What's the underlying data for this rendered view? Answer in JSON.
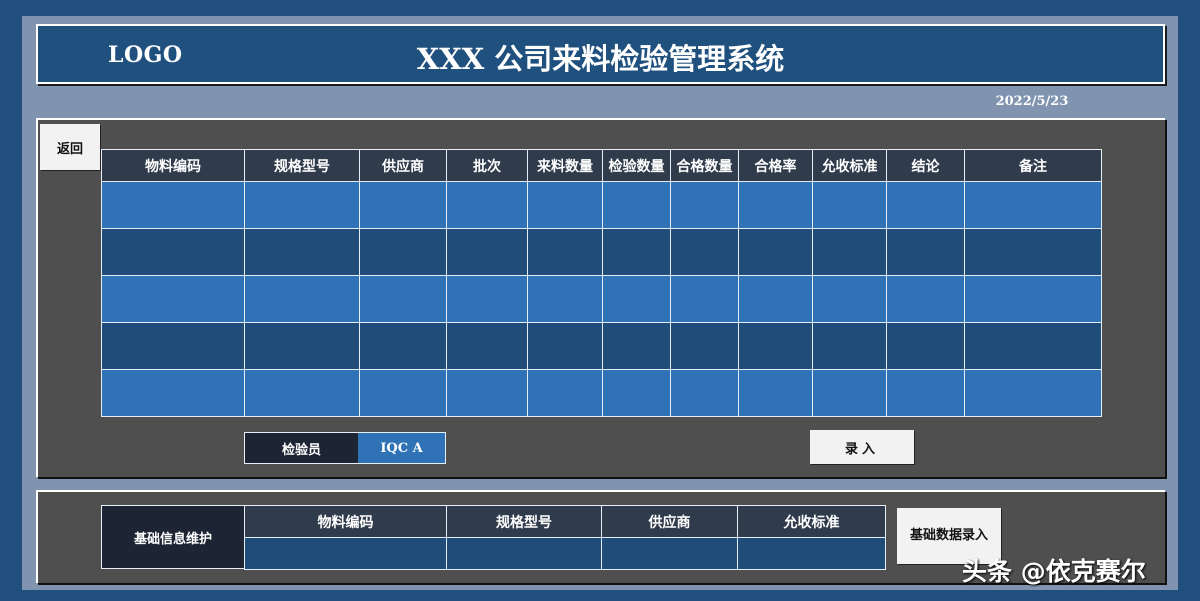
{
  "header": {
    "logo": "LOGO",
    "title": "XXX 公司来料检验管理系统",
    "date": "2022/5/23"
  },
  "buttons": {
    "back": "返回",
    "enter": "录入",
    "basic_entry": "基础数据录入"
  },
  "main_table": {
    "columns": [
      "物料编码",
      "规格型号",
      "供应商",
      "批次",
      "来料数量",
      "检验数量",
      "合格数量",
      "合格率",
      "允收标准",
      "结论",
      "备注"
    ],
    "rows": [
      [
        "",
        "",
        "",
        "",
        "",
        "",
        "",
        "",
        "",
        "",
        ""
      ],
      [
        "",
        "",
        "",
        "",
        "",
        "",
        "",
        "",
        "",
        "",
        ""
      ],
      [
        "",
        "",
        "",
        "",
        "",
        "",
        "",
        "",
        "",
        "",
        ""
      ],
      [
        "",
        "",
        "",
        "",
        "",
        "",
        "",
        "",
        "",
        "",
        ""
      ],
      [
        "",
        "",
        "",
        "",
        "",
        "",
        "",
        "",
        "",
        "",
        ""
      ]
    ]
  },
  "inspector": {
    "label": "检验员",
    "value": "IQC A"
  },
  "basic_info": {
    "label": "基础信息维护",
    "columns": [
      "物料编码",
      "规格型号",
      "供应商",
      "允收标准"
    ],
    "row": [
      "",
      "",
      "",
      ""
    ]
  },
  "watermark": "头条 @依克赛尔",
  "colors": {
    "background": "#21507f",
    "header_cell": "#303b4c",
    "row_light": "#2f73b6",
    "row_dark": "#1f4c79",
    "panel": "#4f4f4f",
    "button": "#f2f2f2"
  }
}
